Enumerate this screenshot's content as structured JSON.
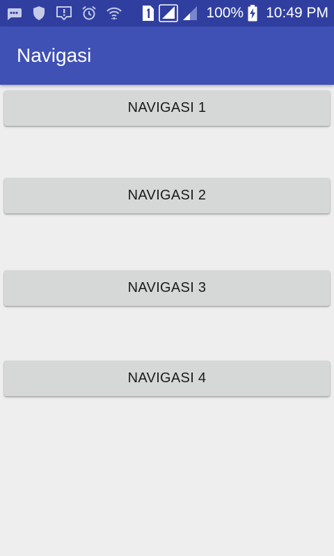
{
  "status_bar": {
    "left_icons": [
      "messaging-icon",
      "shield-icon",
      "alert-notification-icon",
      "alarm-icon",
      "wifi-icon",
      "sim-1-icon",
      "signal-icon",
      "signal-weak-icon"
    ],
    "battery_percent": "100%",
    "time": "10:49 PM"
  },
  "app_bar": {
    "title": "Navigasi",
    "color": "#3f51b5",
    "status_color": "#303f9f"
  },
  "buttons": [
    {
      "label": "NAVIGASI 1"
    },
    {
      "label": "NAVIGASI 2"
    },
    {
      "label": "NAVIGASI 3"
    },
    {
      "label": "NAVIGASI 4"
    }
  ]
}
